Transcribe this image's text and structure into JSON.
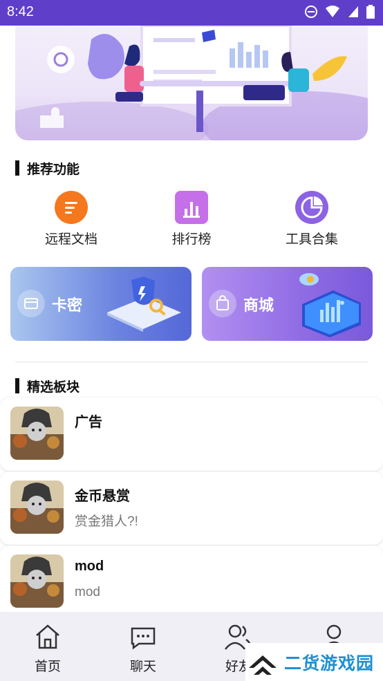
{
  "status_bar": {
    "time": "8:42"
  },
  "sections": {
    "recommended": "推荐功能",
    "featured": "精选板块"
  },
  "features": [
    {
      "label": "远程文档",
      "icon": "doc-icon",
      "color": "#f5781f"
    },
    {
      "label": "排行榜",
      "icon": "ranking-icon",
      "color": "#c56fe9"
    },
    {
      "label": "工具合集",
      "icon": "pie-chart-icon",
      "color": "#8b63e3"
    }
  ],
  "cards": [
    {
      "label": "卡密",
      "icon": "card-key-icon"
    },
    {
      "label": "商城",
      "icon": "shop-bag-icon"
    }
  ],
  "boards": [
    {
      "name": "广告",
      "desc": ""
    },
    {
      "name": "金币悬赏",
      "desc": "赏金猎人?!"
    },
    {
      "name": "mod",
      "desc": "mod"
    }
  ],
  "nav": [
    {
      "label": "首页",
      "icon": "home-icon"
    },
    {
      "label": "聊天",
      "icon": "chat-icon"
    },
    {
      "label": "好友",
      "icon": "friends-icon"
    },
    {
      "label": "我的",
      "icon": "profile-icon"
    }
  ],
  "watermark": {
    "text": "二货游戏园"
  }
}
